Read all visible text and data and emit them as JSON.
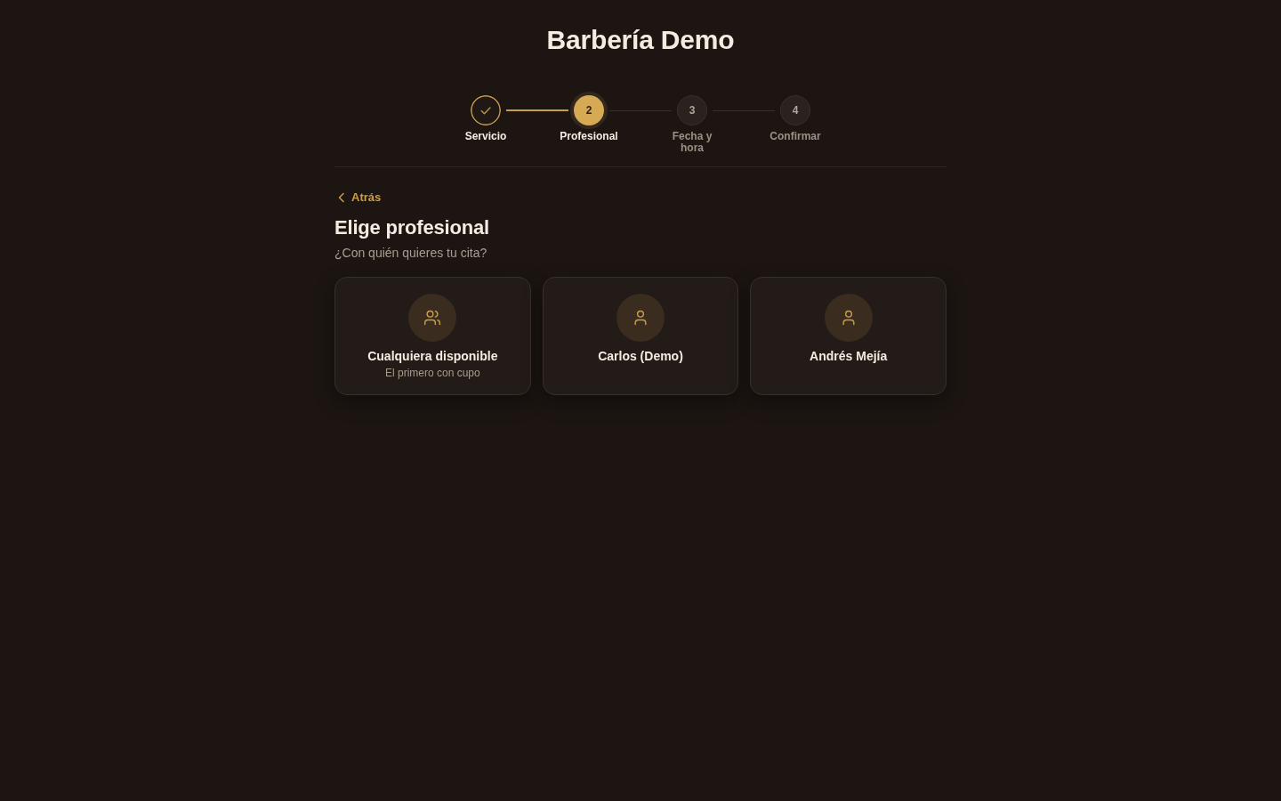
{
  "header": {
    "title": "Barbería Demo"
  },
  "stepper": {
    "steps": [
      {
        "label": "Servicio",
        "done": true,
        "current": false
      },
      {
        "number": "2",
        "label": "Profesional",
        "done": false,
        "current": true
      },
      {
        "number": "3",
        "label": "Fecha y hora",
        "done": false,
        "current": false
      },
      {
        "number": "4",
        "label": "Confirmar",
        "done": false,
        "current": false
      }
    ]
  },
  "back_link": {
    "label": "Atrás"
  },
  "section": {
    "title": "Elige profesional",
    "subtitle": "¿Con quién quieres tu cita?"
  },
  "professionals": [
    {
      "kind": "any",
      "name": "Cualquiera disponible",
      "note": "El primero con cupo",
      "selected": false
    },
    {
      "kind": "person",
      "name": "Carlos (Demo)",
      "selected": false
    },
    {
      "kind": "person",
      "name": "Andrés Mejía",
      "selected": false
    }
  ]
}
